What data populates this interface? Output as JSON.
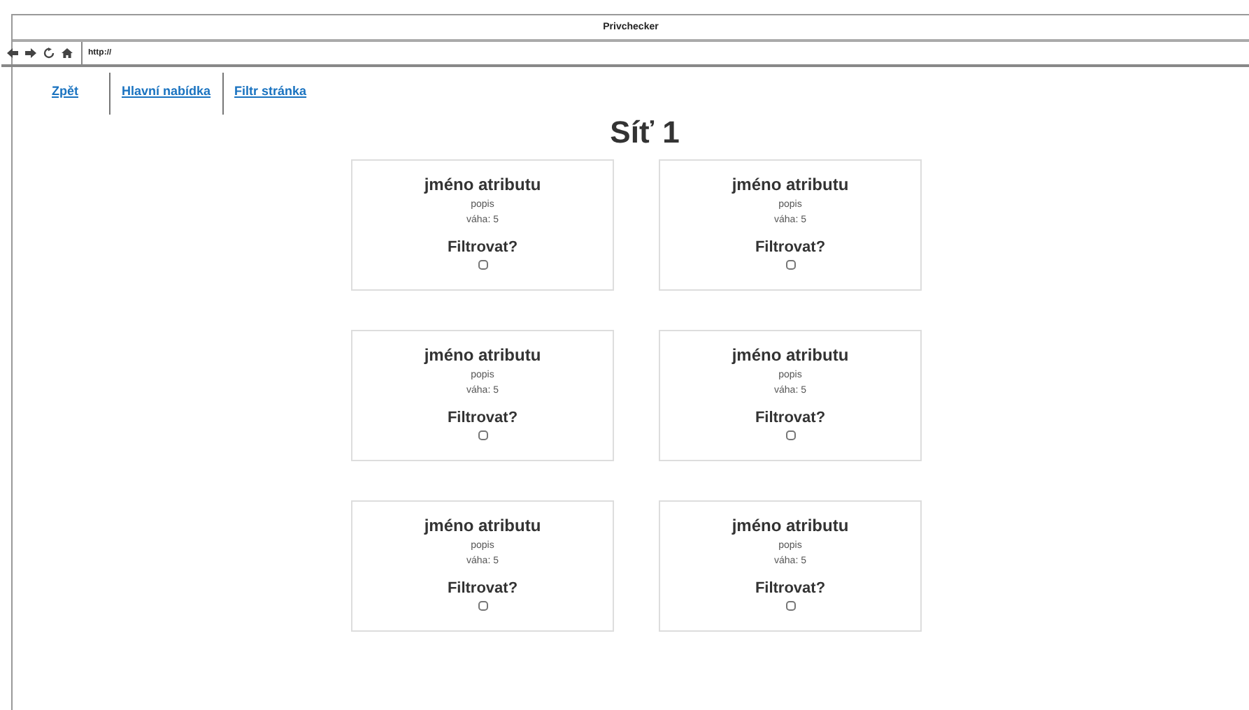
{
  "window": {
    "title": "Privchecker"
  },
  "toolbar": {
    "address": "http://"
  },
  "nav": [
    {
      "label": "Zpět"
    },
    {
      "label": "Hlavní nabídka"
    },
    {
      "label": "Filtr stránka"
    }
  ],
  "heading": "Síť 1",
  "cards": [
    {
      "name": "jméno atributu",
      "description": "popis",
      "weight": "váha: 5",
      "filter_label": "Filtrovat?",
      "checked": false
    },
    {
      "name": "jméno atributu",
      "description": "popis",
      "weight": "váha: 5",
      "filter_label": "Filtrovat?",
      "checked": false
    },
    {
      "name": "jméno atributu",
      "description": "popis",
      "weight": "váha: 5",
      "filter_label": "Filtrovat?",
      "checked": false
    },
    {
      "name": "jméno atributu",
      "description": "popis",
      "weight": "váha: 5",
      "filter_label": "Filtrovat?",
      "checked": false
    },
    {
      "name": "jméno atributu",
      "description": "popis",
      "weight": "váha: 5",
      "filter_label": "Filtrovat?",
      "checked": false
    },
    {
      "name": "jméno atributu",
      "description": "popis",
      "weight": "váha: 5",
      "filter_label": "Filtrovat?",
      "checked": false
    }
  ]
}
